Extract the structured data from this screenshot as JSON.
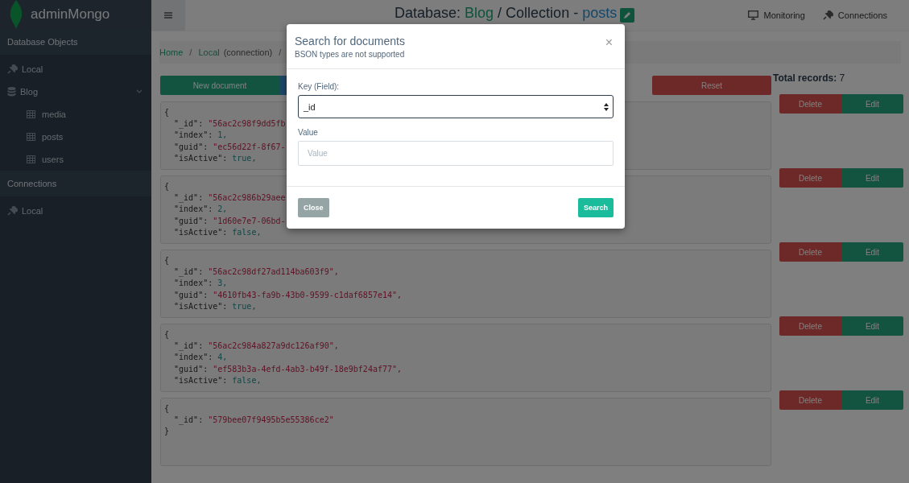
{
  "sidebar": {
    "brand": "adminMongo",
    "sections": [
      {
        "title": "Database Objects",
        "items": [
          {
            "label": "Local",
            "kind": "connection"
          },
          {
            "label": "Blog",
            "kind": "database",
            "expanded": true,
            "children": [
              {
                "label": "media"
              },
              {
                "label": "posts"
              },
              {
                "label": "users"
              }
            ]
          }
        ]
      },
      {
        "title": "Connections",
        "items": [
          {
            "label": "Local",
            "kind": "connection"
          }
        ]
      }
    ]
  },
  "header": {
    "title_prefix": "Database:",
    "database": "Blog",
    "separator": "/ Collection -",
    "collection": "posts",
    "links": [
      {
        "label": "Monitoring",
        "kind": "monitor"
      },
      {
        "label": "Connections",
        "kind": "plug"
      }
    ]
  },
  "breadcrumb": [
    {
      "label": "Home"
    },
    {
      "separator": "/",
      "label": "Local",
      "note": "(connection)"
    },
    {
      "separator": "/"
    }
  ],
  "toolbar": {
    "new_button": "New document",
    "reset_button": "Reset",
    "total_label": "Total records:",
    "total": "7"
  },
  "documents": [
    {
      "open": "{",
      "lines": [
        {
          "key": "\"_id\":",
          "value": "\"56ac2c98f9dd5fb",
          "kind": "string"
        },
        {
          "key": "\"index\":",
          "value": "1,",
          "kind": "number"
        },
        {
          "key": "\"guid\":",
          "value": "\"ec56d22f-8f67-",
          "kind": "string"
        },
        {
          "key": "\"isActive\":",
          "value": "true,",
          "kind": "number"
        }
      ],
      "delete": "Delete",
      "edit": "Edit"
    },
    {
      "open": "{",
      "lines": [
        {
          "key": "\"_id\":",
          "value": "\"56ac2c986b29aee",
          "kind": "string"
        },
        {
          "key": "\"index\":",
          "value": "2,",
          "kind": "number"
        },
        {
          "key": "\"guid\":",
          "value": "\"1d60e7e7-06bd-",
          "kind": "string"
        },
        {
          "key": "\"isActive\":",
          "value": "false,",
          "kind": "number"
        }
      ],
      "delete": "Delete",
      "edit": "Edit"
    },
    {
      "open": "{",
      "lines": [
        {
          "key": "\"_id\":",
          "value": "\"56ac2c98df27ad114ba603f9\",",
          "kind": "string"
        },
        {
          "key": "\"index\":",
          "value": "3,",
          "kind": "number"
        },
        {
          "key": "\"guid\":",
          "value": "\"4610fb43-fa9b-43b0-9599-c1daf6857e14\",",
          "kind": "string"
        },
        {
          "key": "\"isActive\":",
          "value": "true,",
          "kind": "number"
        }
      ],
      "delete": "Delete",
      "edit": "Edit"
    },
    {
      "open": "{",
      "lines": [
        {
          "key": "\"_id\":",
          "value": "\"56ac2c984a827a9dc126af90\",",
          "kind": "string"
        },
        {
          "key": "\"index\":",
          "value": "4,",
          "kind": "number"
        },
        {
          "key": "\"guid\":",
          "value": "\"ef583b3a-4efd-4ab3-b49f-18e9bf24af77\",",
          "kind": "string"
        },
        {
          "key": "\"isActive\":",
          "value": "false,",
          "kind": "number"
        }
      ],
      "delete": "Delete",
      "edit": "Edit"
    },
    {
      "open": "{",
      "lines": [
        {
          "key": "\"_id\":",
          "value": "\"579bee07f9495b5e55386ce2\"",
          "kind": "string"
        }
      ],
      "close": "}",
      "delete": "Delete",
      "edit": "Edit"
    }
  ],
  "modal": {
    "title": "Search for documents",
    "subtitle": "BSON types are not supported",
    "close_icon": "×",
    "key_label": "Key (Field):",
    "key_value": "_id",
    "value_label": "Value",
    "value_placeholder": "Value",
    "close_button": "Close",
    "search_button": "Search"
  }
}
